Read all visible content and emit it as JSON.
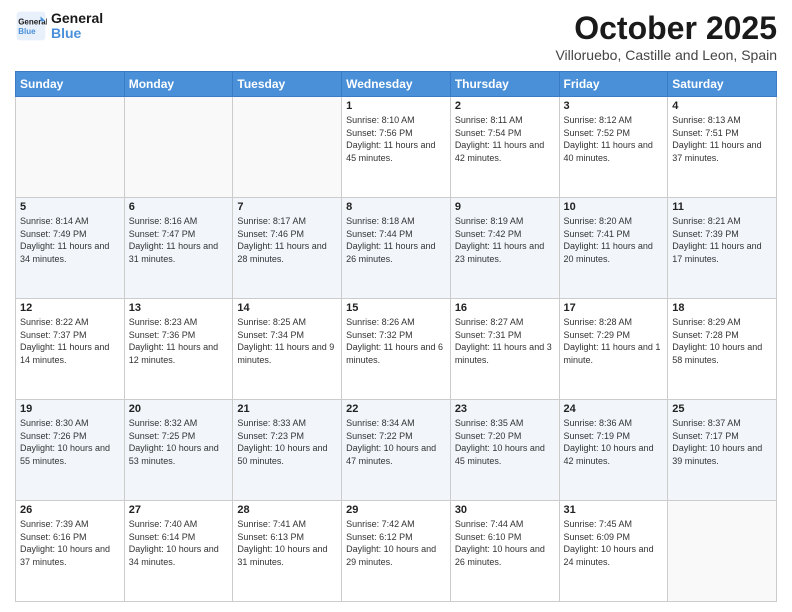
{
  "header": {
    "logo_general": "General",
    "logo_blue": "Blue",
    "month": "October 2025",
    "location": "Villoruebo, Castille and Leon, Spain"
  },
  "days_of_week": [
    "Sunday",
    "Monday",
    "Tuesday",
    "Wednesday",
    "Thursday",
    "Friday",
    "Saturday"
  ],
  "weeks": [
    [
      {
        "day": "",
        "info": ""
      },
      {
        "day": "",
        "info": ""
      },
      {
        "day": "",
        "info": ""
      },
      {
        "day": "1",
        "info": "Sunrise: 8:10 AM\nSunset: 7:56 PM\nDaylight: 11 hours and 45 minutes."
      },
      {
        "day": "2",
        "info": "Sunrise: 8:11 AM\nSunset: 7:54 PM\nDaylight: 11 hours and 42 minutes."
      },
      {
        "day": "3",
        "info": "Sunrise: 8:12 AM\nSunset: 7:52 PM\nDaylight: 11 hours and 40 minutes."
      },
      {
        "day": "4",
        "info": "Sunrise: 8:13 AM\nSunset: 7:51 PM\nDaylight: 11 hours and 37 minutes."
      }
    ],
    [
      {
        "day": "5",
        "info": "Sunrise: 8:14 AM\nSunset: 7:49 PM\nDaylight: 11 hours and 34 minutes."
      },
      {
        "day": "6",
        "info": "Sunrise: 8:16 AM\nSunset: 7:47 PM\nDaylight: 11 hours and 31 minutes."
      },
      {
        "day": "7",
        "info": "Sunrise: 8:17 AM\nSunset: 7:46 PM\nDaylight: 11 hours and 28 minutes."
      },
      {
        "day": "8",
        "info": "Sunrise: 8:18 AM\nSunset: 7:44 PM\nDaylight: 11 hours and 26 minutes."
      },
      {
        "day": "9",
        "info": "Sunrise: 8:19 AM\nSunset: 7:42 PM\nDaylight: 11 hours and 23 minutes."
      },
      {
        "day": "10",
        "info": "Sunrise: 8:20 AM\nSunset: 7:41 PM\nDaylight: 11 hours and 20 minutes."
      },
      {
        "day": "11",
        "info": "Sunrise: 8:21 AM\nSunset: 7:39 PM\nDaylight: 11 hours and 17 minutes."
      }
    ],
    [
      {
        "day": "12",
        "info": "Sunrise: 8:22 AM\nSunset: 7:37 PM\nDaylight: 11 hours and 14 minutes."
      },
      {
        "day": "13",
        "info": "Sunrise: 8:23 AM\nSunset: 7:36 PM\nDaylight: 11 hours and 12 minutes."
      },
      {
        "day": "14",
        "info": "Sunrise: 8:25 AM\nSunset: 7:34 PM\nDaylight: 11 hours and 9 minutes."
      },
      {
        "day": "15",
        "info": "Sunrise: 8:26 AM\nSunset: 7:32 PM\nDaylight: 11 hours and 6 minutes."
      },
      {
        "day": "16",
        "info": "Sunrise: 8:27 AM\nSunset: 7:31 PM\nDaylight: 11 hours and 3 minutes."
      },
      {
        "day": "17",
        "info": "Sunrise: 8:28 AM\nSunset: 7:29 PM\nDaylight: 11 hours and 1 minute."
      },
      {
        "day": "18",
        "info": "Sunrise: 8:29 AM\nSunset: 7:28 PM\nDaylight: 10 hours and 58 minutes."
      }
    ],
    [
      {
        "day": "19",
        "info": "Sunrise: 8:30 AM\nSunset: 7:26 PM\nDaylight: 10 hours and 55 minutes."
      },
      {
        "day": "20",
        "info": "Sunrise: 8:32 AM\nSunset: 7:25 PM\nDaylight: 10 hours and 53 minutes."
      },
      {
        "day": "21",
        "info": "Sunrise: 8:33 AM\nSunset: 7:23 PM\nDaylight: 10 hours and 50 minutes."
      },
      {
        "day": "22",
        "info": "Sunrise: 8:34 AM\nSunset: 7:22 PM\nDaylight: 10 hours and 47 minutes."
      },
      {
        "day": "23",
        "info": "Sunrise: 8:35 AM\nSunset: 7:20 PM\nDaylight: 10 hours and 45 minutes."
      },
      {
        "day": "24",
        "info": "Sunrise: 8:36 AM\nSunset: 7:19 PM\nDaylight: 10 hours and 42 minutes."
      },
      {
        "day": "25",
        "info": "Sunrise: 8:37 AM\nSunset: 7:17 PM\nDaylight: 10 hours and 39 minutes."
      }
    ],
    [
      {
        "day": "26",
        "info": "Sunrise: 7:39 AM\nSunset: 6:16 PM\nDaylight: 10 hours and 37 minutes."
      },
      {
        "day": "27",
        "info": "Sunrise: 7:40 AM\nSunset: 6:14 PM\nDaylight: 10 hours and 34 minutes."
      },
      {
        "day": "28",
        "info": "Sunrise: 7:41 AM\nSunset: 6:13 PM\nDaylight: 10 hours and 31 minutes."
      },
      {
        "day": "29",
        "info": "Sunrise: 7:42 AM\nSunset: 6:12 PM\nDaylight: 10 hours and 29 minutes."
      },
      {
        "day": "30",
        "info": "Sunrise: 7:44 AM\nSunset: 6:10 PM\nDaylight: 10 hours and 26 minutes."
      },
      {
        "day": "31",
        "info": "Sunrise: 7:45 AM\nSunset: 6:09 PM\nDaylight: 10 hours and 24 minutes."
      },
      {
        "day": "",
        "info": ""
      }
    ]
  ]
}
